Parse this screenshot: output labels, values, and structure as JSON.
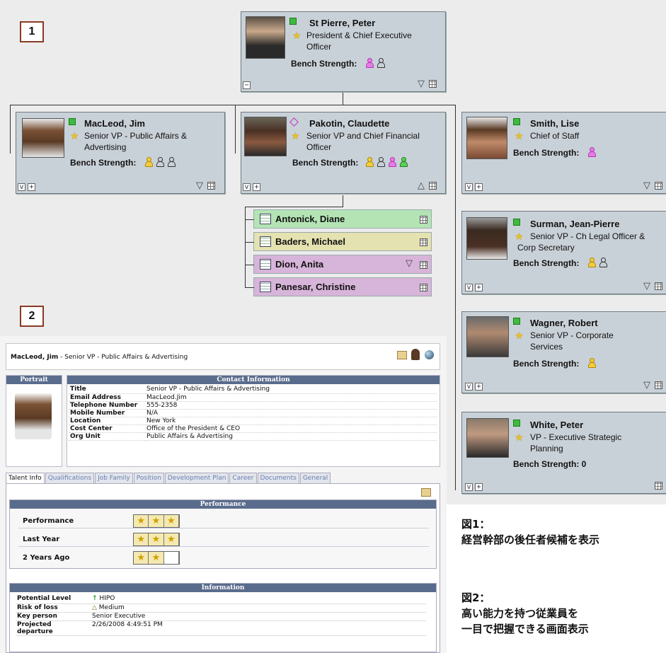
{
  "figure_labels": {
    "fig1": "1",
    "fig2": "2"
  },
  "ceo": {
    "name": "St Pierre, Peter",
    "title_line1": "President & Chief Executive",
    "title_line2": "Officer",
    "bench_label": "Bench Strength:"
  },
  "reports": [
    {
      "name": "MacLeod, Jim",
      "title_line1": "Senior VP - Public Affairs &",
      "title_line2": "Advertising",
      "bench_label": "Bench Strength:"
    },
    {
      "name": "Pakotin, Claudette",
      "title_line1": "Senior VP and Chief Financial",
      "title_line2": "Officer",
      "bench_label": "Bench Strength:"
    },
    {
      "name": "Smith, Lise",
      "title_line1": "Chief of Staff",
      "title_line2": "",
      "bench_label": "Bench Strength:"
    },
    {
      "name": "Surman, Jean-Pierre",
      "title_line1": "Senior VP - Ch Legal Officer &",
      "title_line2": "Corp Secretary",
      "bench_label": "Bench Strength:"
    },
    {
      "name": "Wagner, Robert",
      "title_line1": "Senior VP - Corporate",
      "title_line2": "Services",
      "bench_label": "Bench Strength:"
    },
    {
      "name": "White, Peter",
      "title_line1": "VP - Executive Strategic",
      "title_line2": "Planning",
      "bench_label": "Bench Strength: 0"
    }
  ],
  "sub_reports": [
    {
      "name": "Antonick, Diane",
      "color": "#b4e4b4"
    },
    {
      "name": "Baders, Michael",
      "color": "#e4e2b0"
    },
    {
      "name": "Dion, Anita",
      "color": "#d7b4d9"
    },
    {
      "name": "Panesar, Christine",
      "color": "#d7b4d9"
    }
  ],
  "profile": {
    "header_name": "MacLeod, Jim",
    "header_title": " - Senior VP - Public Affairs & Advertising",
    "portrait_label": "Portrait",
    "contact_header": "Contact Information",
    "contact": [
      {
        "k": "Title",
        "v": "Senior VP - Public Affairs & Advertising"
      },
      {
        "k": "Email Address",
        "v": "MacLeod.Jim"
      },
      {
        "k": "Telephone Number",
        "v": "555-2358"
      },
      {
        "k": "Mobile Number",
        "v": "N/A"
      },
      {
        "k": "Location",
        "v": "New York"
      },
      {
        "k": "Cost Center",
        "v": "Office of the President & CEO"
      },
      {
        "k": "Org Unit",
        "v": "Public Affairs & Advertising"
      }
    ],
    "tabs": [
      "Talent Info",
      "Qualifications",
      "Job Family",
      "Position",
      "Development Plan",
      "Career",
      "Documents",
      "General"
    ],
    "performance_header": "Performance",
    "performance": [
      {
        "label": "Performance",
        "stars": 3
      },
      {
        "label": "Last Year",
        "stars": 3
      },
      {
        "label": "2 Years Ago",
        "stars": 2
      }
    ],
    "information_header": "Information",
    "information": [
      {
        "k": "Potential Level",
        "v": "HIPO"
      },
      {
        "k": "Risk of loss",
        "v": "Medium"
      },
      {
        "k": "Key person",
        "v": "Senior Executive"
      },
      {
        "k": "Projected departure",
        "v": "2/26/2008 4:49:51 PM"
      }
    ]
  },
  "captions": {
    "fig1_title": "図1：",
    "fig1_text": "経営幹部の後任者候補を表示",
    "fig2_title": "図2：",
    "fig2_line1": "高い能力を持つ従業員を",
    "fig2_line2": "一目で把握できる画面表示"
  },
  "colors": {
    "green_status": "#3cbc3c",
    "gold_bench": "#e8c020",
    "magenta_bench": "#c030c0",
    "header_bar": "#5a6c8c"
  }
}
